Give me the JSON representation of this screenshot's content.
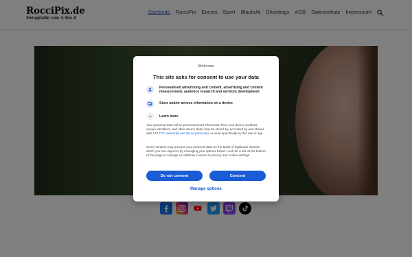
{
  "site": {
    "logo_title": "RocciPix.de",
    "logo_subtitle": "Fotografie von A bis Z",
    "nav": [
      "Startseite",
      "RocciPix",
      "Events",
      "Sport",
      "Blaulicht",
      "Shootings",
      "AGB",
      "Datenschutz",
      "Impressum"
    ],
    "search_icon": "search-icon"
  },
  "social": [
    "facebook-icon",
    "instagram-icon",
    "youtube-icon",
    "twitter-icon",
    "twitch-icon",
    "tiktok-icon"
  ],
  "consent": {
    "welcome": "Welcome",
    "title": "This site asks for consent to use your data",
    "purposes": [
      "Personalised advertising and content, advertising and content measurement, audience research and services development",
      "Store and/or access information on a device"
    ],
    "learn_more": "Learn more",
    "body1_a": "Your personal data will be processed and information from your device (cookies, unique identifiers, and other device data) may be stored by, accessed by and shared with ",
    "body1_link": "132 TCF vendor(s) and 65 ad partner(s)",
    "body1_b": ", or used specifically by this site or app.",
    "body2": "Some vendors may process your personal data on the basis of legitimate interest, which you can object to by managing your options below. Look for a link at the bottom of this page to manage or withdraw consent in privacy and cookie settings.",
    "btn_deny": "Do not consent",
    "btn_consent": "Consent",
    "manage": "Manage options"
  },
  "colors": {
    "accent": "#1a5bd6",
    "nav_active": "#3d62b3"
  }
}
